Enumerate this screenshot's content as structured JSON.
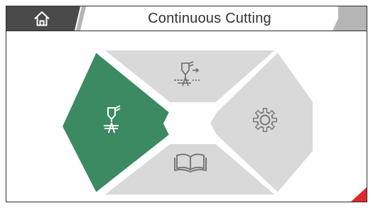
{
  "header": {
    "title": "Continuous Cutting",
    "home_icon": "home-icon",
    "right_tab_icon": "tab-arrow"
  },
  "menu": {
    "items": [
      {
        "id": "cutting",
        "icon": "cutting-torch-icon",
        "state": "selected"
      },
      {
        "id": "continuous-cut-settings",
        "icon": "torch-path-icon",
        "state": "normal"
      },
      {
        "id": "settings",
        "icon": "gear-icon",
        "state": "normal"
      },
      {
        "id": "manual",
        "icon": "book-icon",
        "state": "normal"
      }
    ]
  },
  "colors": {
    "selected": "#3b8a62",
    "normal": "#d9d9d9",
    "icon": "#777777",
    "icon_selected": "#ffffff",
    "header_dark": "#4a4a4a",
    "header_gray": "#b5b5b5",
    "accent": "#e02828"
  }
}
